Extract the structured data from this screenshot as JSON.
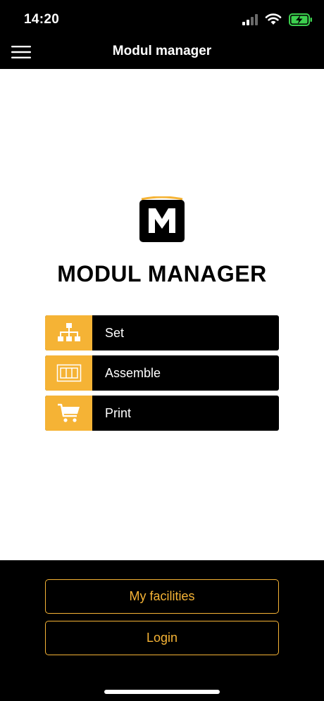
{
  "status_bar": {
    "time": "14:20",
    "icons": [
      "signal-icon",
      "wifi-icon",
      "battery-charging-icon"
    ]
  },
  "nav": {
    "title": "Modul manager",
    "menu_icon": "hamburger-menu-icon"
  },
  "brand": {
    "logo_letter": "M",
    "title": "MODUL MANAGER"
  },
  "menu": {
    "items": [
      {
        "label": "Set",
        "icon": "hierarchy-icon"
      },
      {
        "label": "Assemble",
        "icon": "module-panel-icon"
      },
      {
        "label": "Print",
        "icon": "cart-icon"
      }
    ]
  },
  "actions": {
    "facilities_label": "My facilities",
    "login_label": "Login"
  },
  "colors": {
    "accent": "#f5b335",
    "background": "#ffffff",
    "bar": "#000000"
  }
}
